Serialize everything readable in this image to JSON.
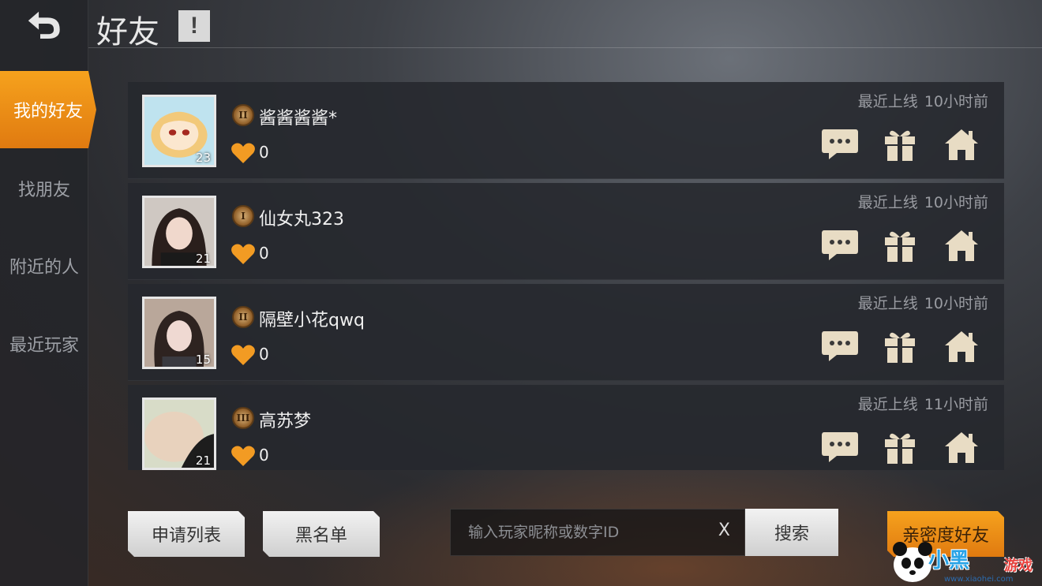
{
  "header": {
    "title": "好友",
    "alert_label": "!"
  },
  "sidebar": {
    "items": [
      {
        "label": "我的好友",
        "active": true
      },
      {
        "label": "找朋友",
        "active": false
      },
      {
        "label": "附近的人",
        "active": false
      },
      {
        "label": "最近玩家",
        "active": false
      }
    ]
  },
  "friends": [
    {
      "name": "酱酱酱酱*",
      "rank": "II",
      "level": "23",
      "likes": "0",
      "last_online_label": "最近上线",
      "last_online_time": "10小时前"
    },
    {
      "name": "仙女丸323",
      "rank": "I",
      "level": "21",
      "likes": "0",
      "last_online_label": "最近上线",
      "last_online_time": "10小时前"
    },
    {
      "name": "隔壁小花qwq",
      "rank": "II",
      "level": "15",
      "likes": "0",
      "last_online_label": "最近上线",
      "last_online_time": "10小时前"
    },
    {
      "name": "高苏梦",
      "rank": "III",
      "level": "21",
      "likes": "0",
      "last_online_label": "最近上线",
      "last_online_time": "11小时前"
    }
  ],
  "bottom_bar": {
    "request_list_label": "申请列表",
    "blacklist_label": "黑名单",
    "search_placeholder": "输入玩家昵称或数字ID",
    "clear_label": "X",
    "search_label": "搜索",
    "intimacy_label": "亲密度好友"
  },
  "watermark": {
    "brand": "小黑",
    "suffix": "游戏",
    "url": "www.xiaohei.com"
  },
  "colors": {
    "accent": "#f0901a",
    "panel": "#26282d"
  }
}
